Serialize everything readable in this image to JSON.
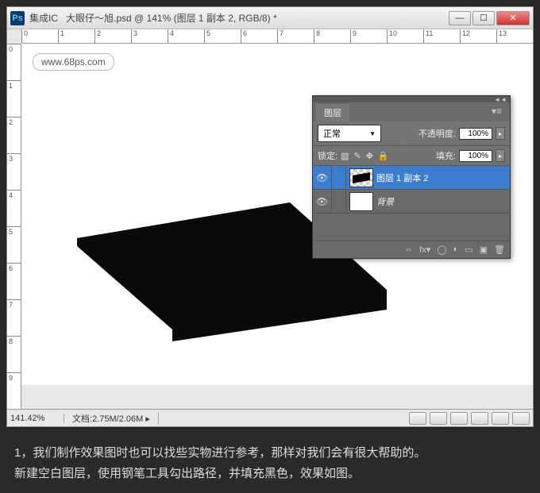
{
  "titlebar": {
    "app_prefix": "集成IC",
    "title": "大眼仔～旭.psd @ 141% (图层 1 副本 2, RGB/8) *"
  },
  "watermark": "www.68ps.com",
  "ruler_h": [
    "0",
    "1",
    "2",
    "3",
    "4",
    "5",
    "6",
    "7",
    "8",
    "9",
    "10",
    "11",
    "12",
    "13"
  ],
  "ruler_v": [
    "0",
    "1",
    "2",
    "3",
    "4",
    "5",
    "6",
    "7",
    "8",
    "9"
  ],
  "layers_panel": {
    "tab": "图层",
    "blend_mode": "正常",
    "opacity_label": "不透明度:",
    "opacity_value": "100%",
    "lock_label": "锁定:",
    "fill_label": "填充:",
    "fill_value": "100%",
    "layers": [
      {
        "name": "图层 1 副本 2",
        "selected": true,
        "checker": true
      },
      {
        "name": "背景",
        "selected": false,
        "checker": false,
        "italic": true
      }
    ]
  },
  "statusbar": {
    "zoom": "141.42%",
    "doc_label": "文档:",
    "doc_info": "2.75M/2.06M"
  },
  "caption_line1": "1，我们制作效果图时也可以找些实物进行参考，那样对我们会有很大帮助的。",
  "caption_line2": "新建空白图层，使用钢笔工具勾出路径，并填充黑色，效果如图。"
}
